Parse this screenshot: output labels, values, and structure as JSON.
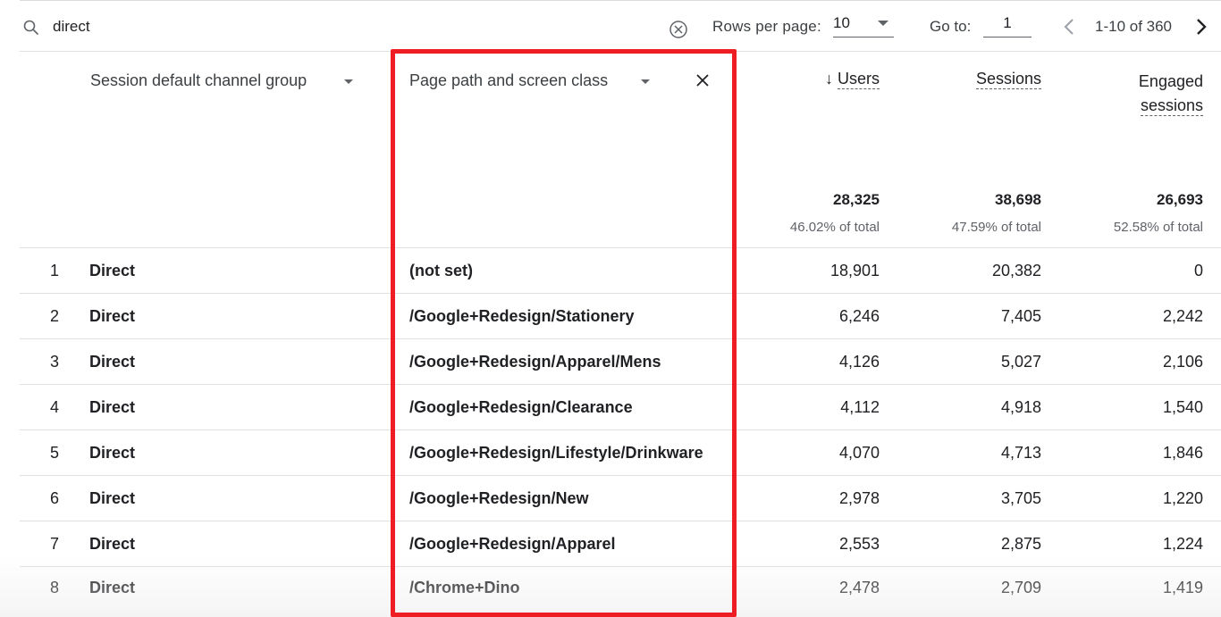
{
  "toolbar": {
    "search_value": "direct",
    "rows_per_page_label": "Rows per page:",
    "rows_per_page_value": "10",
    "goto_label": "Go to:",
    "goto_value": "1",
    "page_range": "1-10 of 360"
  },
  "columns": {
    "dimension1": "Session default channel group",
    "dimension2": "Page path and screen class",
    "users": "Users",
    "sessions": "Sessions",
    "engaged_line1": "Engaged",
    "engaged_line2": "sessions",
    "sort_indicator": "↓"
  },
  "totals": {
    "users": "28,325",
    "users_pct": "46.02% of total",
    "sessions": "38,698",
    "sessions_pct": "47.59% of total",
    "engaged": "26,693",
    "engaged_pct": "52.58% of total"
  },
  "rows": [
    {
      "idx": "1",
      "channel": "Direct",
      "path": "(not set)",
      "users": "18,901",
      "sessions": "20,382",
      "engaged": "0"
    },
    {
      "idx": "2",
      "channel": "Direct",
      "path": "/Google+Redesign/Stationery",
      "users": "6,246",
      "sessions": "7,405",
      "engaged": "2,242"
    },
    {
      "idx": "3",
      "channel": "Direct",
      "path": "/Google+Redesign/Apparel/Mens",
      "users": "4,126",
      "sessions": "5,027",
      "engaged": "2,106"
    },
    {
      "idx": "4",
      "channel": "Direct",
      "path": "/Google+Redesign/Clearance",
      "users": "4,112",
      "sessions": "4,918",
      "engaged": "1,540"
    },
    {
      "idx": "5",
      "channel": "Direct",
      "path": "/Google+Redesign/Lifestyle/Drinkware",
      "users": "4,070",
      "sessions": "4,713",
      "engaged": "1,846"
    },
    {
      "idx": "6",
      "channel": "Direct",
      "path": "/Google+Redesign/New",
      "users": "2,978",
      "sessions": "3,705",
      "engaged": "1,220"
    },
    {
      "idx": "7",
      "channel": "Direct",
      "path": "/Google+Redesign/Apparel",
      "users": "2,553",
      "sessions": "2,875",
      "engaged": "1,224"
    },
    {
      "idx": "8",
      "channel": "Direct",
      "path": "/Chrome+Dino",
      "users": "2,478",
      "sessions": "2,709",
      "engaged": "1,419"
    }
  ],
  "colors": {
    "highlight_border": "#ee1d23",
    "text_primary": "#202124",
    "text_secondary": "#5f6368",
    "divider": "#e0e0e0"
  },
  "icons": {
    "search": "search-icon",
    "clear": "clear-circle-x-icon",
    "dropdown": "caret-down-icon",
    "remove_dimension": "close-icon",
    "prev": "chevron-left-icon",
    "next": "chevron-right-icon",
    "sort": "arrow-down-icon"
  }
}
